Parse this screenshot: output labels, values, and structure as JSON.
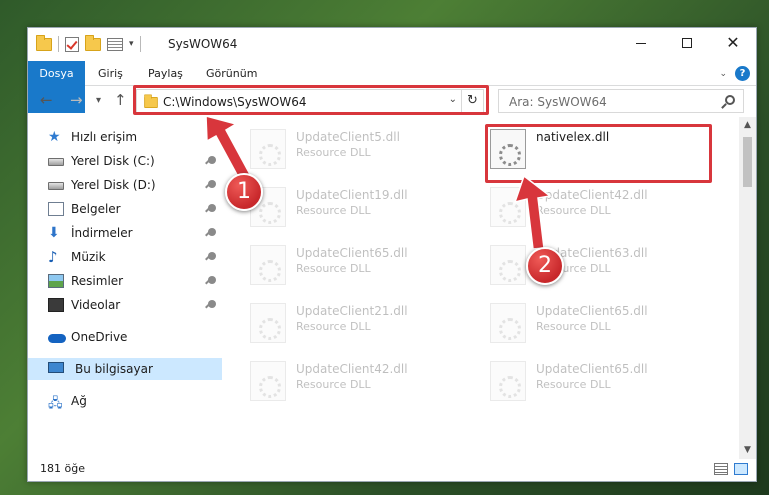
{
  "window": {
    "title": "SysWOW64",
    "min_label": "",
    "max_label": "",
    "close_label": "✕"
  },
  "ribbon": {
    "tabs": [
      {
        "label": "Dosya"
      },
      {
        "label": "Giriş"
      },
      {
        "label": "Paylaş"
      },
      {
        "label": "Görünüm"
      }
    ],
    "help_label": "?"
  },
  "address": {
    "path": "C:\\Windows\\SysWOW64",
    "refresh_icon": "↻"
  },
  "search": {
    "placeholder": "Ara: SysWOW64"
  },
  "sidebar": {
    "items": [
      {
        "label": "Hızlı erişim",
        "icon": "star-icon"
      },
      {
        "label": "Yerel Disk (C:)",
        "icon": "drive-icon",
        "pinned": true
      },
      {
        "label": "Yerel Disk (D:)",
        "icon": "drive-icon",
        "pinned": true
      },
      {
        "label": "Belgeler",
        "icon": "documents-icon",
        "pinned": true
      },
      {
        "label": "İndirmeler",
        "icon": "download-icon",
        "pinned": true
      },
      {
        "label": "Müzik",
        "icon": "music-icon",
        "pinned": true
      },
      {
        "label": "Resimler",
        "icon": "pictures-icon",
        "pinned": true
      },
      {
        "label": "Videolar",
        "icon": "video-icon",
        "pinned": true
      },
      {
        "label": "OneDrive",
        "icon": "onedrive-icon"
      },
      {
        "label": "Bu bilgisayar",
        "icon": "computer-icon",
        "selected": true
      },
      {
        "label": "Ağ",
        "icon": "network-icon"
      }
    ]
  },
  "files": [
    {
      "name": "UpdateClient5.dll",
      "type": "Resource DLL",
      "faded": true
    },
    {
      "name": "nativelex.dll",
      "type": "",
      "faded": false,
      "highlighted": true
    },
    {
      "name": "UpdateClient19.dll",
      "type": "Resource DLL",
      "faded": true
    },
    {
      "name": "UpdateClient42.dll",
      "type": "Resource DLL",
      "faded": true
    },
    {
      "name": "UpdateClient65.dll",
      "type": "Resource DLL",
      "faded": true
    },
    {
      "name": "UpdateClient63.dll",
      "type": "Resource DLL",
      "faded": true
    },
    {
      "name": "UpdateClient21.dll",
      "type": "Resource DLL",
      "faded": true
    },
    {
      "name": "UpdateClient65.dll",
      "type": "Resource DLL",
      "faded": true
    },
    {
      "name": "UpdateClient42.dll",
      "type": "Resource DLL",
      "faded": true
    },
    {
      "name": "UpdateClient65.dll",
      "type": "Resource DLL",
      "faded": true
    }
  ],
  "status": {
    "count": "181 öğe"
  },
  "annotations": {
    "callout_1": "1",
    "callout_2": "2",
    "color": "#d8363c"
  }
}
